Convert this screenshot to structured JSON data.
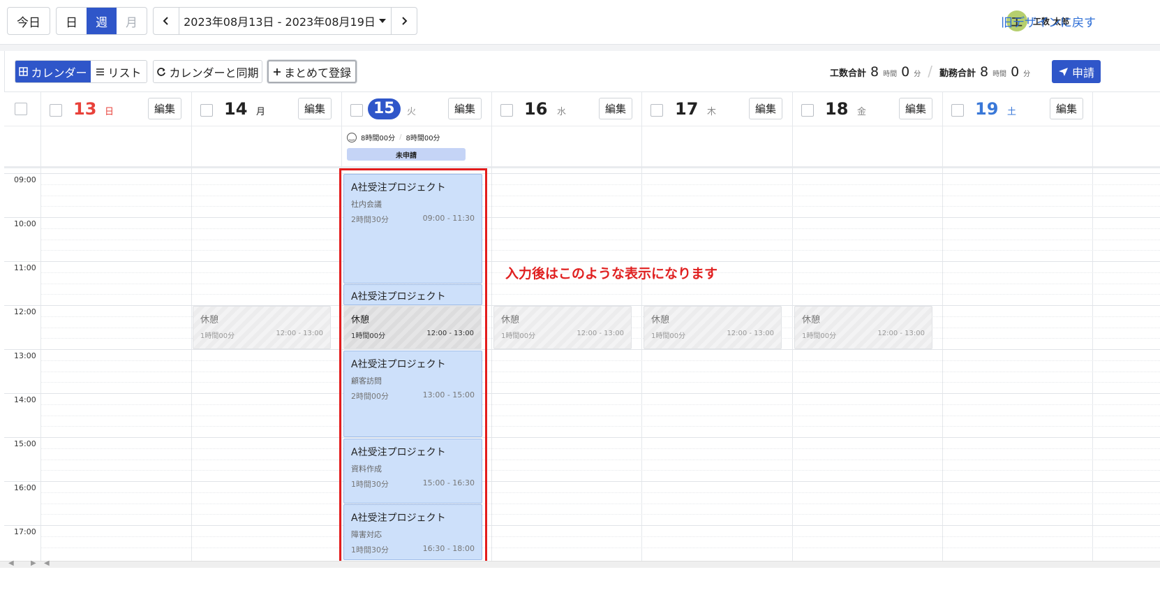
{
  "topbar": {
    "today": "今日",
    "views": [
      "日",
      "週",
      "月"
    ],
    "prev": "‹",
    "next": "›",
    "range": "2023年08月13日 - 2023年08月19日",
    "avatar_initial": "工",
    "username": "工数 太郎",
    "old_design": "旧デザインに戻す"
  },
  "toolbar": {
    "calendar": "カレンダー",
    "list": "リスト",
    "sync": "カレンダーと同期",
    "bulk": "まとめて登録",
    "work_label": "工数合計",
    "work_hours": "8",
    "work_minutes": "0",
    "attend_label": "勤務合計",
    "attend_hours": "8",
    "attend_minutes": "0",
    "unit_hour": "時間",
    "unit_min": "分",
    "apply": "申請"
  },
  "days": [
    {
      "num": "13",
      "wd": "日",
      "color": "#e8413a"
    },
    {
      "num": "14",
      "wd": "月",
      "color": "#222222"
    },
    {
      "num": "15",
      "wd": "火",
      "color": "#ffffff"
    },
    {
      "num": "16",
      "wd": "水",
      "color": "#222222"
    },
    {
      "num": "17",
      "wd": "木",
      "color": "#222222"
    },
    {
      "num": "18",
      "wd": "金",
      "color": "#222222"
    },
    {
      "num": "19",
      "wd": "土",
      "color": "#3a78d8"
    }
  ],
  "edit_label": "編集",
  "summary": {
    "work": "8時間00分",
    "attend": "8時間00分",
    "status": "未申請"
  },
  "hours": [
    "09:00",
    "10:00",
    "11:00",
    "12:00",
    "13:00",
    "14:00",
    "15:00",
    "16:00",
    "17:00"
  ],
  "events": [
    {
      "title": "A社受注プロジェクト",
      "sub": "社内会議",
      "dur": "2時間30分",
      "time": "09:00 - 11:30"
    },
    {
      "title": "A社受注プロジェクト",
      "sub": "",
      "dur": "",
      "time": ""
    },
    {
      "title": "A社受注プロジェクト",
      "sub": "顧客訪問",
      "dur": "2時間00分",
      "time": "13:00 - 15:00"
    },
    {
      "title": "A社受注プロジェクト",
      "sub": "資料作成",
      "dur": "1時間30分",
      "time": "15:00 - 16:30"
    },
    {
      "title": "A社受注プロジェクト",
      "sub": "障害対応",
      "dur": "1時間30分",
      "time": "16:30 - 18:00"
    }
  ],
  "rest": {
    "title": "休憩",
    "dur": "1時間00分",
    "time": "12:00 - 13:00"
  },
  "annotation": "入力後はこのような表示になります"
}
